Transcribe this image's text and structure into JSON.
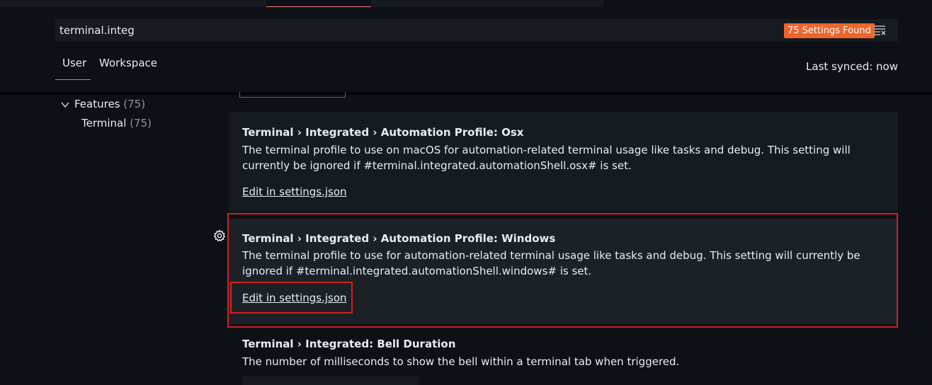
{
  "search": {
    "value": "terminal.integ",
    "results_badge": "75 Settings Found",
    "clear_icon": "clear-filter-icon"
  },
  "tabs": [
    {
      "label": "User"
    },
    {
      "label": "Workspace"
    }
  ],
  "sync_status": "Last synced: now",
  "toc": {
    "features": {
      "label": "Features",
      "count": "(75)"
    },
    "terminal": {
      "label": "Terminal",
      "count": "(75)"
    }
  },
  "settings": [
    {
      "title": "Terminal › Integrated › Automation Profile: Osx",
      "description": "The terminal profile to use on macOS for automation-related terminal usage like tasks and debug. This setting will currently be ignored if #terminal.integrated.automationShell.osx# is set.",
      "link": "Edit in settings.json"
    },
    {
      "title": "Terminal › Integrated › Automation Profile: Windows",
      "description": "The terminal profile to use for automation-related terminal usage like tasks and debug. This setting will currently be ignored if #terminal.integrated.automationShell.windows# is set.",
      "link": "Edit in settings.json"
    },
    {
      "title": "Terminal › Integrated: Bell Duration",
      "description": "The number of milliseconds to show the bell within a terminal tab when triggered."
    }
  ],
  "colors": {
    "background": "#0d1117",
    "badge": "#f0652b",
    "highlight": "#d61f1f"
  }
}
